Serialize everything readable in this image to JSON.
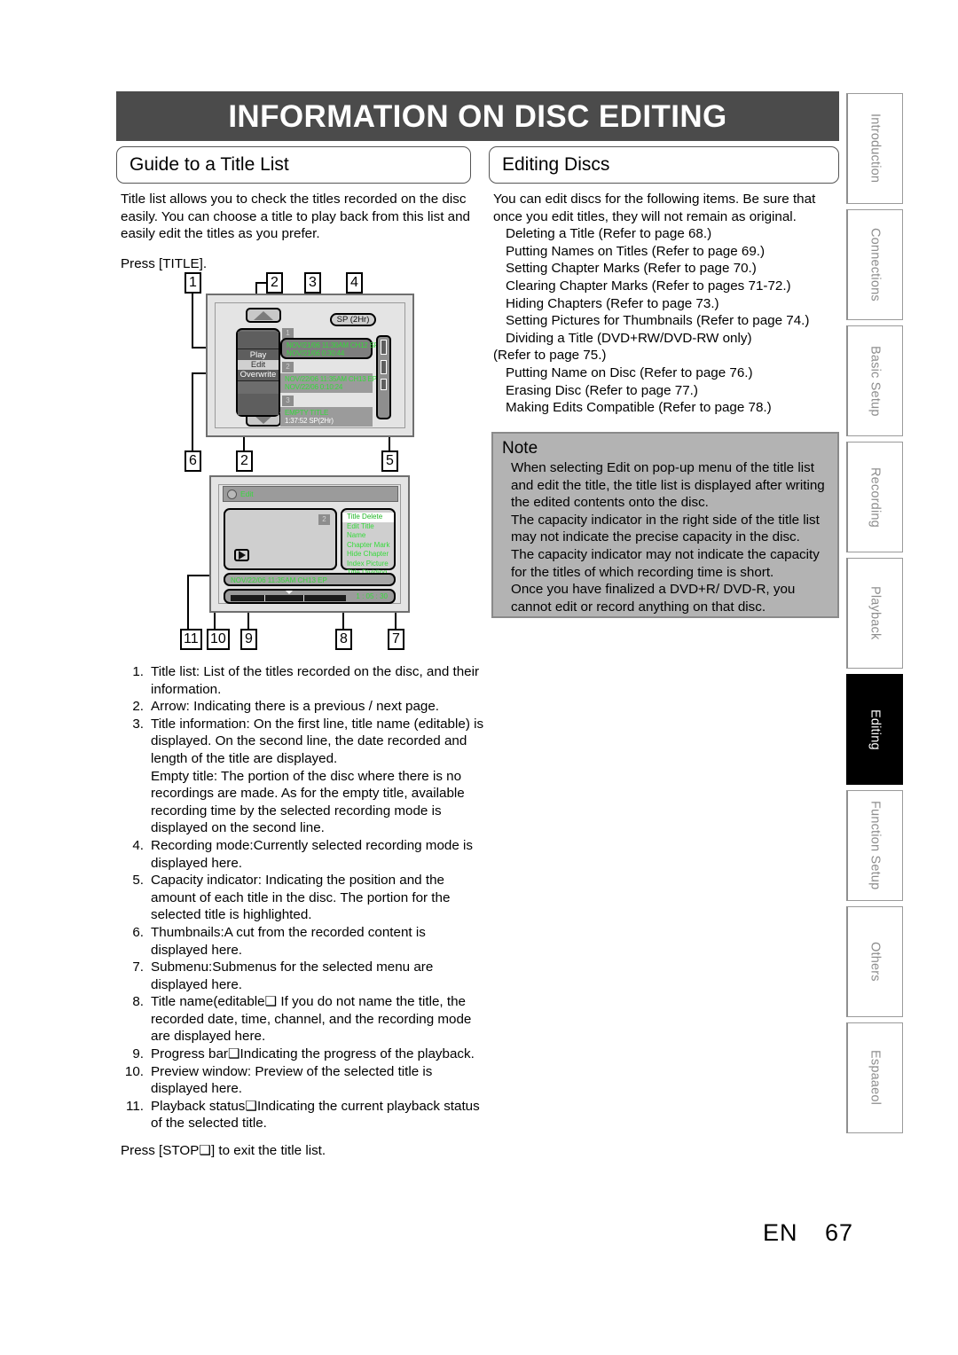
{
  "header": {
    "title": "INFORMATION ON DISC EDITING"
  },
  "sections": {
    "left_heading": "Guide to a Title List",
    "right_heading": "Editing Discs"
  },
  "left_column": {
    "intro": "Title list allows you to check the titles recorded on the disc easily. You can choose a title to play back from this list and easily edit the titles as you prefer.",
    "press_title": "Press [TITLE].",
    "press_stop": "Press [STOP❑] to exit the title list."
  },
  "right_column": {
    "intro": "You can edit discs for the following items. Be sure that once you edit titles, they will not remain as original.",
    "items": [
      "Deleting a Title (Refer to page 68.)",
      "Putting Names on Titles (Refer to page 69.)",
      "Setting Chapter Marks (Refer to page 70.)",
      "Clearing Chapter Marks (Refer to pages 71-72.)",
      "Hiding Chapters (Refer to page 73.)",
      "Setting Pictures for Thumbnails (Refer to page 74.)",
      "Dividing a Title (DVD+RW/DVD-RW only)",
      "(Refer to page 75.)",
      "Putting Name on Disc (Refer to page 76.)",
      "Erasing Disc (Refer to page 77.)",
      "Making Edits Compatible (Refer to page 78.)"
    ]
  },
  "note": {
    "title": "Note",
    "paragraphs": [
      "When selecting  Edit  on pop-up menu of the title list and edit the title, the title list is displayed after writing the edited contents onto the disc.",
      "The capacity indicator in the right side of the title list may not indicate the precise capacity in the disc.",
      "The capacity indicator may not indicate the capacity for the titles of which recording time is short.",
      "Once you have finalized a DVD+R/ DVD-R, you cannot edit or record anything on that disc."
    ]
  },
  "numbered_list": [
    {
      "num": "1.",
      "text": "Title list: List of the titles recorded on the disc, and their information.",
      "extra": null
    },
    {
      "num": "2.",
      "text": "Arrow: Indicating there is a previous / next page.",
      "extra": null
    },
    {
      "num": "3.",
      "text": "Title information: On the first line, title name (editable) is displayed. On the second line, the date recorded and length of the title are displayed.",
      "extra": "Empty title: The portion of the disc where there is no recordings are made. As for the empty title, available recording time by the selected recording mode is displayed on the second line."
    },
    {
      "num": "4.",
      "text": "Recording mode:Currently selected recording mode is displayed here.",
      "extra": null
    },
    {
      "num": "5.",
      "text": "Capacity indicator: Indicating the position and the amount of each title in the disc. The portion for the selected title is highlighted.",
      "extra": null
    },
    {
      "num": "6.",
      "text": "Thumbnails:A cut from the recorded content is displayed here.",
      "extra": null
    },
    {
      "num": "7.",
      "text": "Submenu:Submenus for the selected menu are displayed here.",
      "extra": null
    },
    {
      "num": "8.",
      "text": "Title name(editable❑ If you do not name the title, the recorded date, time, channel, and the recording mode are displayed here.",
      "extra": null
    },
    {
      "num": "9.",
      "text": "Progress bar❑Indicating the progress of the playback.",
      "extra": null
    },
    {
      "num": "10.",
      "text": "Preview window: Preview of the selected title is displayed here.",
      "extra": null
    },
    {
      "num": "11.",
      "text": "Playback status❑Indicating the current playback status of the selected title.",
      "extra": null
    }
  ],
  "diagram_title_list": {
    "callouts": [
      "1",
      "2",
      "3",
      "4",
      "6",
      "2",
      "5"
    ],
    "mode_pill": "SP (2Hr)",
    "popup_menu": [
      "Play",
      "Edit",
      "Overwrite"
    ],
    "popup_selected": "Edit",
    "titles": [
      {
        "index": "1",
        "line1": "NOV/21/06  11:30AM CH12  SP",
        "line2": "NOV/21/06     0:30:44",
        "selected": true
      },
      {
        "index": "2",
        "line1": "NOV/22/06  11:35AM CH13  EP",
        "line2": "NOV/22/06     0:10:24",
        "selected": false
      },
      {
        "index": "3",
        "line1": "EMPTY TITLE",
        "line2": "1:37:52  SP(2Hr)",
        "selected": false
      }
    ]
  },
  "diagram_edit": {
    "callouts": [
      "11",
      "10",
      "9",
      "8",
      "7"
    ],
    "header_label": "Edit",
    "preview_number": "2",
    "submenu": [
      "Title Delete",
      "Edit Title Name",
      "Chapter Mark",
      "Hide Chapter",
      "Index Picture",
      "Title Dividing"
    ],
    "submenu_selected": "Title Delete",
    "title_name": "NOV/22/06 11:35AM CH13 EP",
    "elapsed_time": "1 : 05 : 30"
  },
  "tabs": [
    {
      "label": "Introduction",
      "active": false
    },
    {
      "label": "Connections",
      "active": false
    },
    {
      "label": "Basic Setup",
      "active": false
    },
    {
      "label": "Recording",
      "active": false
    },
    {
      "label": "Playback",
      "active": false
    },
    {
      "label": "Editing",
      "active": true
    },
    {
      "label": "Function Setup",
      "active": false
    },
    {
      "label": "Others",
      "active": false
    },
    {
      "label": "Espaaeol",
      "active": false
    }
  ],
  "footer": {
    "lang": "EN",
    "page": "67"
  }
}
